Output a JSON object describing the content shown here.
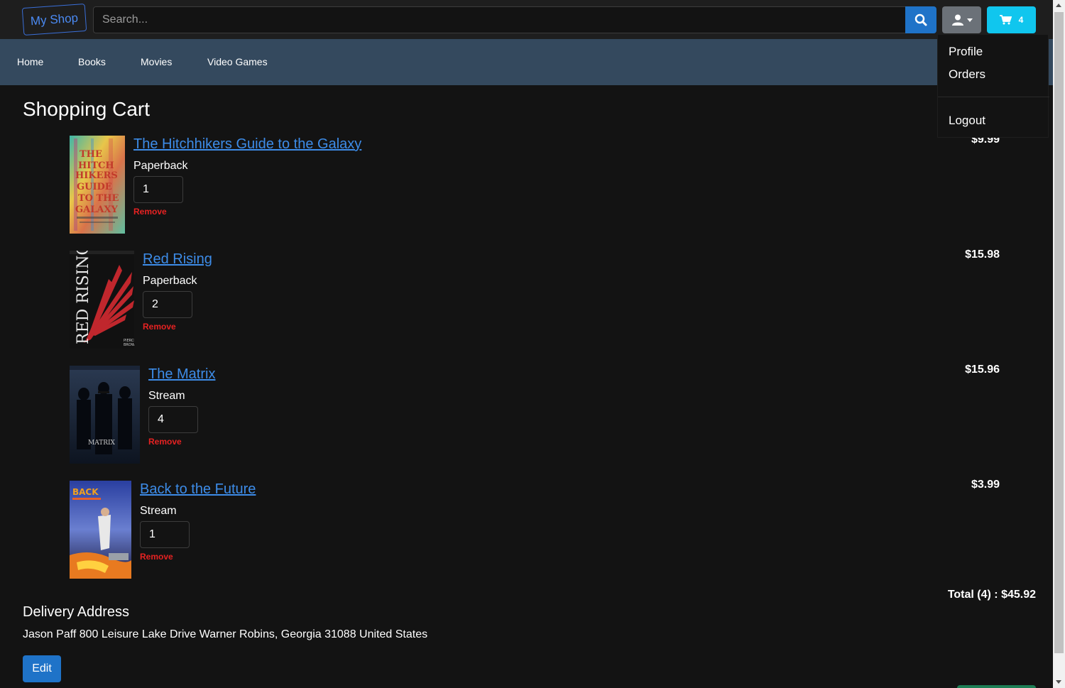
{
  "header": {
    "brand": "My Shop",
    "search_placeholder": "Search...",
    "search_icon": "search-icon",
    "user_icon": "user-icon",
    "cart_icon": "cart-icon",
    "cart_count": "4",
    "colors": {
      "search_button": "#1f73c8",
      "user_button": "#6b7178",
      "cart_button": "#10c6ee"
    }
  },
  "nav": {
    "items": [
      {
        "label": "Home"
      },
      {
        "label": "Books"
      },
      {
        "label": "Movies"
      },
      {
        "label": "Video Games"
      }
    ],
    "background": "#34495e"
  },
  "user_menu": {
    "profile": "Profile",
    "orders": "Orders",
    "logout": "Logout"
  },
  "cart": {
    "title": "Shopping Cart",
    "remove_label": "Remove",
    "items": [
      {
        "title": "The Hitchhikers Guide to the Galaxy",
        "format": "Paperback",
        "quantity": "1",
        "price": "$9.99"
      },
      {
        "title": "Red Rising",
        "format": "Paperback",
        "quantity": "2",
        "price": "$15.98"
      },
      {
        "title": "The Matrix",
        "format": "Stream",
        "quantity": "4",
        "price": "$15.96"
      },
      {
        "title": "Back to the Future",
        "format": "Stream",
        "quantity": "1",
        "price": "$3.99"
      }
    ],
    "total_label": "Total (4) : $45.92"
  },
  "delivery": {
    "title": "Delivery Address",
    "address": "Jason Paff 800 Leisure Lake Drive Warner Robins, Georgia 31088 United States",
    "edit_label": "Edit"
  }
}
